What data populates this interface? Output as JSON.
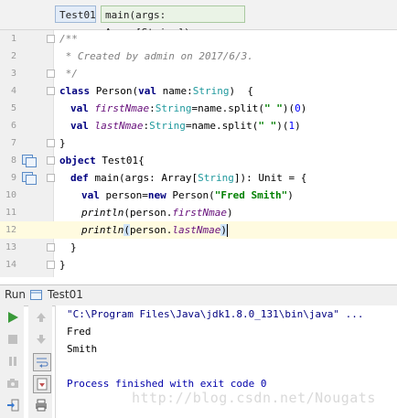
{
  "breadcrumb": {
    "class_crumb": "Test01",
    "method_crumb": "main(args: Array[String])"
  },
  "editor": {
    "line_numbers": [
      "1",
      "2",
      "3",
      "4",
      "5",
      "6",
      "7",
      "8",
      "9",
      "10",
      "11",
      "12",
      "13",
      "14"
    ],
    "lines": {
      "l1_comment": "/**",
      "l2_comment": " * Created by admin on 2017/6/3.",
      "l3_comment": " */",
      "l4_kw": "class",
      "l4_name": " Person(",
      "l4_val": "val",
      "l4_param": " name:",
      "l4_type": "String",
      "l4_end": ")  {",
      "l5_val": "val",
      "l5_field": "firstNmae",
      "l5_colon": ":",
      "l5_type": "String",
      "l5_expr": "=name.split(",
      "l5_str": "\" \"",
      "l5_close": ")(",
      "l5_idx": "0",
      "l5_end": ")",
      "l6_val": "val",
      "l6_field": "lastNmae",
      "l6_colon": ":",
      "l6_type": "String",
      "l6_expr": "=name.split(",
      "l6_str": "\" \"",
      "l6_close": ")(",
      "l6_idx": "1",
      "l6_end": ")",
      "l7": "}",
      "l8_kw": "object",
      "l8_name": " Test01{",
      "l9_def": "def",
      "l9_sig": " main(args: Array[",
      "l9_type": "String",
      "l9_ret": "]): Unit = {",
      "l10_val": "val",
      "l10_var": " person=",
      "l10_new": "new",
      "l10_ctor": " Person(",
      "l10_str": "\"Fred Smith\"",
      "l10_end": ")",
      "l11_fn": "println",
      "l11_arg": "(person.",
      "l11_field": "firstNmae",
      "l11_end": ")",
      "l12_fn": "println",
      "l12_paren": "(",
      "l12_arg": "person.",
      "l12_field": "lastNmae",
      "l12_end": ")",
      "l13": "}",
      "l14": "}"
    }
  },
  "run_panel": {
    "title": "Run",
    "config_name": "Test01",
    "tools_left": [
      "run-icon",
      "stop-icon",
      "pause-icon",
      "camera-icon",
      "login-icon"
    ],
    "tools_right": [
      "up-arrow-icon",
      "down-arrow-icon",
      "wrap-icon",
      "scroll-to-end-icon",
      "print-icon"
    ],
    "console": {
      "cmd": "\"C:\\Program Files\\Java\\jdk1.8.0_131\\bin\\java\" ...",
      "out1": "Fred",
      "out2": "Smith",
      "exit": "Process finished with exit code 0"
    }
  },
  "watermark": "http://blog.csdn.net/Nougats",
  "colors": {
    "keyword": "#000080",
    "string": "#008000",
    "field": "#660e7a",
    "type": "#20999d",
    "comment": "#808080",
    "current_line": "#fffbe0"
  }
}
